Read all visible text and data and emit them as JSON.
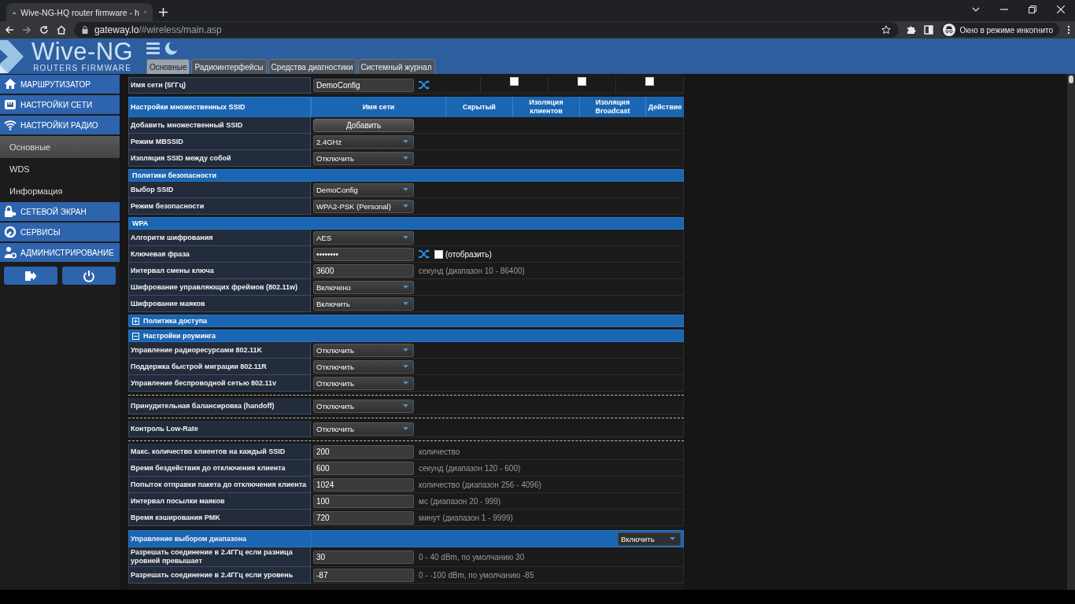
{
  "browser": {
    "tab_title": "Wive-NG-HQ router firmware - h",
    "url_host": "gateway.lo",
    "url_path": "/#wireless/main.asp",
    "profile_label": "Окно в режиме инкогнито"
  },
  "header": {
    "logo_title": "Wive-NG",
    "logo_subtitle": "ROUTERS FIRMWARE",
    "tabs": [
      {
        "label": "Основные",
        "selected": true
      },
      {
        "label": "Радиоинтерфейсы",
        "selected": false
      },
      {
        "label": "Средства диагностики",
        "selected": false
      },
      {
        "label": "Системный журнал",
        "selected": false
      }
    ]
  },
  "sidebar": {
    "items": [
      {
        "kind": "section",
        "label": "МАРШРУТИЗАТОР"
      },
      {
        "kind": "section",
        "label": "НАСТРОЙКИ СЕТИ"
      },
      {
        "kind": "section",
        "label": "НАСТРОЙКИ РАДИО"
      },
      {
        "kind": "page",
        "label": "Основные",
        "selected": true
      },
      {
        "kind": "page",
        "label": "WDS",
        "selected": false
      },
      {
        "kind": "page",
        "label": "Информация",
        "selected": false
      },
      {
        "kind": "section",
        "label": "СЕТЕВОЙ ЭКРАН"
      },
      {
        "kind": "section",
        "label": "СЕРВИСЫ"
      },
      {
        "kind": "section",
        "label": "АДМИНИСТРИРОВАНИЕ"
      }
    ]
  },
  "form": {
    "rows": [
      {
        "kind": "text",
        "label": "Имя сети (5ГГц)",
        "value": "DemoConfig",
        "shuffle": true,
        "checkboxes": [
          {
            "checked": false
          },
          {
            "checked": false
          },
          {
            "checked": false
          }
        ]
      },
      {
        "kind": "columns",
        "label": "Настройки множественных SSID",
        "columns": [
          "Имя сети",
          "Скрытый",
          "Изоляция клиентов",
          "Изоляция Broadcast",
          "Действие"
        ]
      },
      {
        "kind": "button",
        "label": "Добавить множественный SSID",
        "button": "Добавить"
      },
      {
        "kind": "select",
        "label": "Режим MBSSID",
        "value": "2.4GHz"
      },
      {
        "kind": "select",
        "label": "Изоляция SSID между собой",
        "value": "Отключить"
      },
      {
        "kind": "section",
        "label": "Политики безопасности"
      },
      {
        "kind": "select",
        "label": "Выбор SSID",
        "value": "DemoConfig"
      },
      {
        "kind": "select",
        "label": "Режим безопасности",
        "value": "WPA2-PSK (Personal)"
      },
      {
        "kind": "section",
        "label": "WPA"
      },
      {
        "kind": "select",
        "label": "Алгоритм шифрования",
        "value": "AES"
      },
      {
        "kind": "password",
        "label": "Ключевая фраза",
        "value": "••••••••",
        "shuffle": true,
        "reveal": {
          "label": "(отобразить)",
          "checked": false
        }
      },
      {
        "kind": "text",
        "label": "Интервал смены ключа",
        "value": "3600",
        "hint": "секунд (диапазон  10 - 86400)"
      },
      {
        "kind": "select",
        "label": "Шифрование управляющих фреймов (802.11w)",
        "value": "Включено"
      },
      {
        "kind": "select",
        "label": "Шифрование маяков",
        "value": "Включить"
      },
      {
        "kind": "section",
        "label": "Политика доступа",
        "expanded": false
      },
      {
        "kind": "section",
        "label": "Настройки роуминга",
        "expanded": true
      },
      {
        "kind": "select",
        "label": "Управление радиоресурсами 802.11K",
        "value": "Отключить"
      },
      {
        "kind": "select",
        "label": "Поддержка быстрой миграции 802.11R",
        "value": "Отключить"
      },
      {
        "kind": "select",
        "label": "Управление беспроводной сетью 802.11v",
        "value": "Отключить"
      },
      {
        "kind": "divider"
      },
      {
        "kind": "select",
        "label": "Принудительная балансировка (handoff)",
        "value": "Отключить"
      },
      {
        "kind": "divider"
      },
      {
        "kind": "select",
        "label": "Контроль Low-Rate",
        "value": "Отключить"
      },
      {
        "kind": "divider"
      },
      {
        "kind": "text",
        "label": "Макс. количество клиентов на каждый SSID",
        "value": "200",
        "hint": "количество"
      },
      {
        "kind": "text",
        "label": "Время бездействия до отключения клиента",
        "value": "600",
        "hint": "секунд (диапазон 120 - 600)"
      },
      {
        "kind": "text",
        "label": "Попыток отправки пакета до отключения клиента",
        "value": "1024",
        "hint": "количество (диапазон 256 - 4096)"
      },
      {
        "kind": "text",
        "label": "Интервал посылки маяков",
        "value": "100",
        "hint": "мс (диапазон 20 - 999)"
      },
      {
        "kind": "text",
        "label": "Время кэширования PMK",
        "value": "720",
        "hint": "минут (диапазон 1 - 9999)"
      },
      {
        "kind": "section_select",
        "label": "Управление выбором диапазона",
        "value": "Включить"
      },
      {
        "kind": "text",
        "label": "Разрешать соединение в 2.4ГГц если разница уровней превышает",
        "value": "30",
        "hint": "0 - 40 dBm, по умолчанию 30"
      },
      {
        "kind": "text",
        "label": "Разрешать соединение в 2.4ГГц если уровень",
        "value": "-87",
        "hint": "0 - -100 dBm, по умолчанию -85"
      }
    ]
  }
}
